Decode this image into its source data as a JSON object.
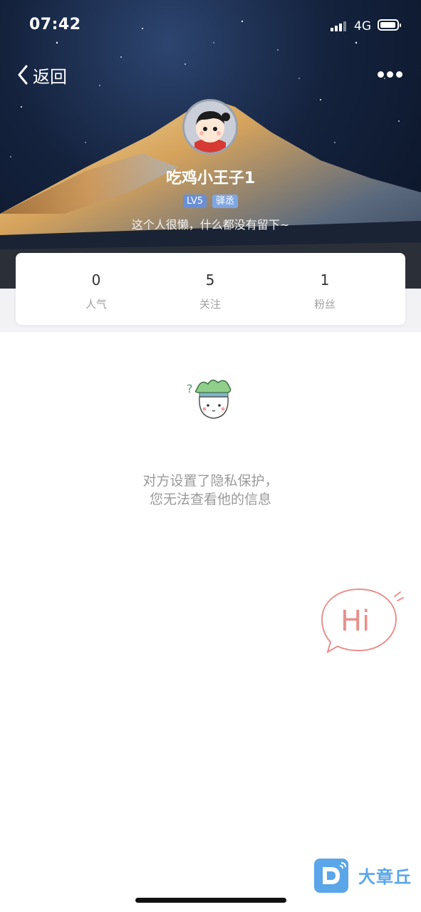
{
  "status_bar": {
    "time": "07:42",
    "network": "4G"
  },
  "nav": {
    "back_label": "返回"
  },
  "profile": {
    "username": "吃鸡小王子1",
    "level_badge": "LV5",
    "title_badge": "驿丞",
    "bio": "这个人很懒，什么都没有留下~"
  },
  "stats": [
    {
      "value": "0",
      "label": "人气"
    },
    {
      "value": "5",
      "label": "关注"
    },
    {
      "value": "1",
      "label": "粉丝"
    }
  ],
  "privacy": {
    "line1": "对方设置了隐私保护，",
    "line2": "您无法查看他的信息"
  },
  "hi_bubble": {
    "label": "Hi",
    "color": "#e8908e"
  },
  "watermark": {
    "text": "大章丘",
    "color": "#5aa6e8"
  },
  "colors": {
    "accent_blue": "#6a8fd4",
    "stats_bg": "#ffffff",
    "band_bg": "#f2f2f4"
  }
}
